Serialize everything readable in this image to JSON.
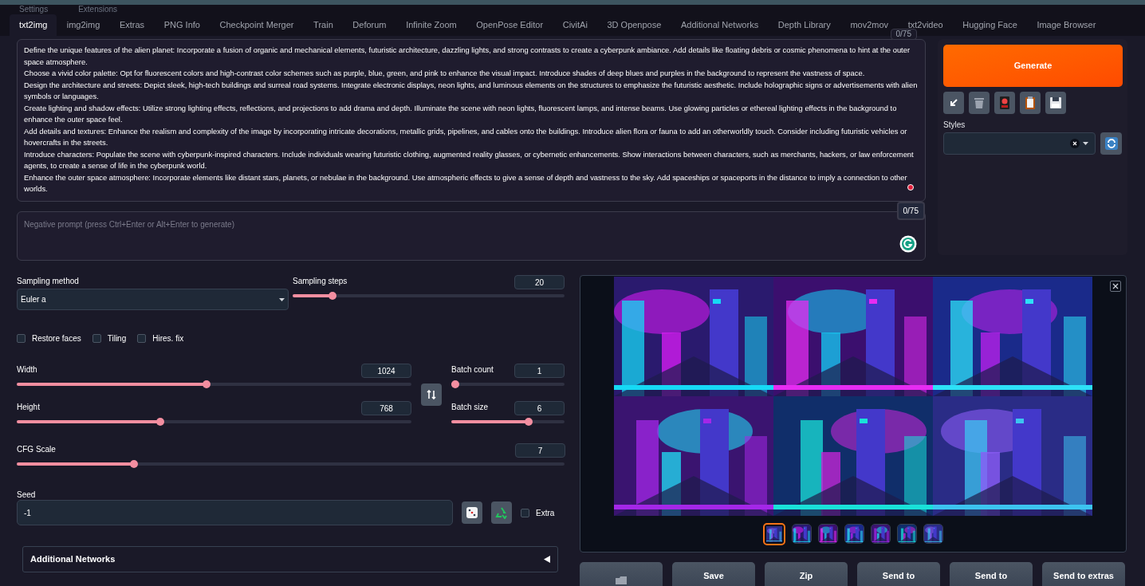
{
  "top_tabs": [
    {
      "label": "Settings",
      "selected": false
    },
    {
      "label": "Extensions",
      "selected": false
    }
  ],
  "tabs": [
    {
      "label": "txt2img",
      "selected": true
    },
    {
      "label": "img2img",
      "selected": false
    },
    {
      "label": "Extras",
      "selected": false
    },
    {
      "label": "PNG Info",
      "selected": false
    },
    {
      "label": "Checkpoint Merger",
      "selected": false
    },
    {
      "label": "Train",
      "selected": false
    },
    {
      "label": "Deforum",
      "selected": false
    },
    {
      "label": "Infinite Zoom",
      "selected": false
    },
    {
      "label": "OpenPose Editor",
      "selected": false
    },
    {
      "label": "CivitAi",
      "selected": false
    },
    {
      "label": "3D Openpose",
      "selected": false
    },
    {
      "label": "Additional Networks",
      "selected": false
    },
    {
      "label": "Depth Library",
      "selected": false
    },
    {
      "label": "mov2mov",
      "selected": false
    },
    {
      "label": "txt2video",
      "selected": false
    },
    {
      "label": "Hugging Face",
      "selected": false
    },
    {
      "label": "Image Browser",
      "selected": false
    }
  ],
  "prompt": {
    "token_count": "0/75",
    "value": "Define the unique features of the alien planet: Incorporate a fusion of organic and mechanical elements, futuristic architecture, dazzling lights, and strong contrasts to create a cyberpunk ambiance. Add details like floating debris or cosmic phenomena to hint at the outer space atmosphere.\nChoose a vivid color palette: Opt for fluorescent colors and high-contrast color schemes such as purple, blue, green, and pink to enhance the visual impact. Introduce shades of deep blues and purples in the background to represent the vastness of space.\nDesign the architecture and streets: Depict sleek, high-tech buildings and surreal road systems. Integrate electronic displays, neon lights, and luminous elements on the structures to emphasize the futuristic aesthetic. Include holographic signs or advertisements with alien symbols or languages.\nCreate lighting and shadow effects: Utilize strong lighting effects, reflections, and projections to add drama and depth. Illuminate the scene with neon lights, fluorescent lamps, and intense beams. Use glowing particles or ethereal lighting effects in the background to enhance the outer space feel.\nAdd details and textures: Enhance the realism and complexity of the image by incorporating intricate decorations, metallic grids, pipelines, and cables onto the buildings. Introduce alien flora or fauna to add an otherworldly touch. Consider including futuristic vehicles or hovercrafts in the streets.\nIntroduce characters: Populate the scene with cyberpunk-inspired characters. Include individuals wearing futuristic clothing, augmented reality glasses, or cybernetic enhancements. Show interactions between characters, such as merchants, hackers, or law enforcement agents, to create a sense of life in the cyberpunk world.\nEnhance the outer space atmosphere: Incorporate elements like distant stars, planets, or nebulae in the background. Use atmospheric effects to give a sense of depth and vastness to the sky. Add spaceships or spaceports in the distance to imply a connection to other worlds."
  },
  "negative_prompt": {
    "token_count": "0/75",
    "placeholder": "Negative prompt (press Ctrl+Enter or Alt+Enter to generate)"
  },
  "generate_button": "Generate",
  "styles": {
    "label": "Styles"
  },
  "sampling_method": {
    "label": "Sampling method",
    "value": "Euler a"
  },
  "sliders": [
    {
      "label": "Sampling steps",
      "value": "20",
      "level": 0.135
    },
    {
      "label": "Width",
      "value": "1024",
      "level": 0.48
    },
    {
      "label": "Batch count",
      "value": "1",
      "level": 0
    },
    {
      "label": "Height",
      "value": "768",
      "level": 0.36
    },
    {
      "label": "Batch size",
      "value": "6",
      "level": 0.7
    },
    {
      "label": "CFG Scale",
      "value": "7",
      "level": 0.21
    }
  ],
  "checkboxes": [
    {
      "label": "Restore faces",
      "checked": false
    },
    {
      "label": "Tiling",
      "checked": false
    },
    {
      "label": "Hires. fix",
      "checked": false
    }
  ],
  "seed": {
    "label": "Seed",
    "value": "-1",
    "extra_label": "Extra",
    "extra_checked": false
  },
  "accordion": {
    "label": "Additional Networks",
    "expanded": false
  },
  "gallery": {
    "thumbnails": [
      {
        "selected": true
      },
      {
        "selected": false
      },
      {
        "selected": false
      },
      {
        "selected": false
      },
      {
        "selected": false
      },
      {
        "selected": false
      },
      {
        "selected": false
      }
    ]
  },
  "action_buttons": [
    {
      "kind": "icon"
    },
    {
      "kind": "text",
      "label": "Save"
    },
    {
      "kind": "text",
      "label": "Zip"
    },
    {
      "kind": "text",
      "label": "Send to"
    },
    {
      "kind": "text",
      "label": "Send to"
    },
    {
      "kind": "text",
      "label": "Send to extras"
    }
  ]
}
